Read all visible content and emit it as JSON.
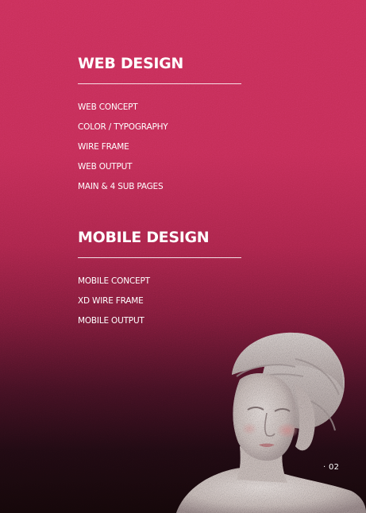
{
  "web_section": {
    "title": "WEB DESIGN",
    "items": [
      "WEB CONCEPT",
      "COLOR / TYPOGRAPHY",
      "WIRE FRAME",
      "WEB OUTPUT",
      "MAIN & 4 SUB PAGES"
    ]
  },
  "mobile_section": {
    "title": "MOBILE DESIGN",
    "items": [
      "MOBILE CONCEPT",
      "XD WIRE FRAME",
      "MOBILE OUTPUT"
    ]
  },
  "page_number": "· 02",
  "colors": {
    "background_top": "#c82e58",
    "background_bottom": "#140709",
    "text": "#ffffff"
  }
}
